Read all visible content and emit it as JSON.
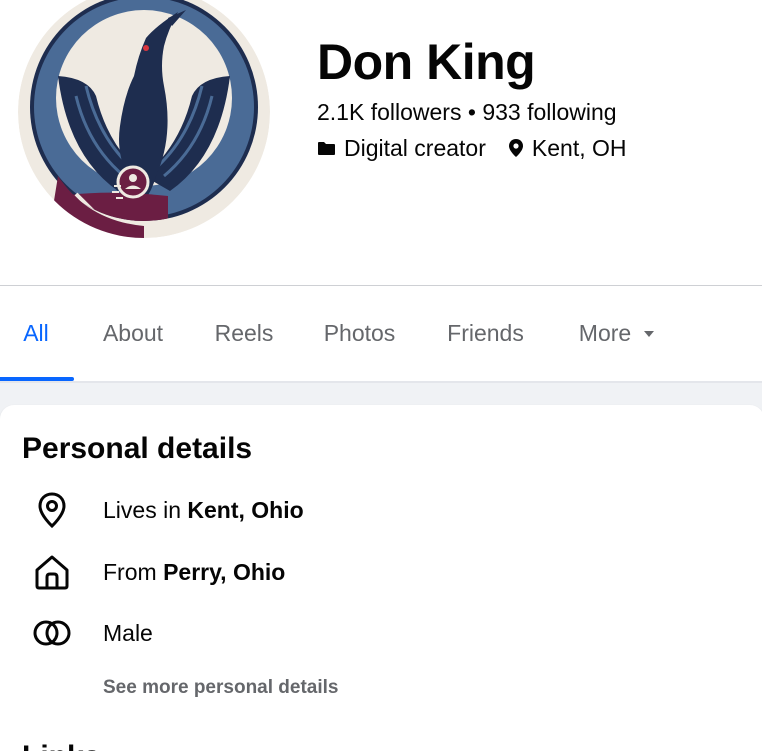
{
  "profile": {
    "name": "Don King",
    "followers": "2.1K followers",
    "separator": "•",
    "following": "933 following",
    "category": "Digital creator",
    "location": "Kent, OH"
  },
  "tabs": [
    {
      "label": "All",
      "active": true
    },
    {
      "label": "About"
    },
    {
      "label": "Reels"
    },
    {
      "label": "Photos"
    },
    {
      "label": "Friends"
    },
    {
      "label": "More"
    }
  ],
  "personal_details": {
    "title": "Personal details",
    "items": [
      {
        "icon": "location-pin-icon",
        "prefix": "Lives in ",
        "value": "Kent, Ohio"
      },
      {
        "icon": "home-icon",
        "prefix": "From ",
        "value": "Perry, Ohio"
      },
      {
        "icon": "gender-icon",
        "prefix": "",
        "value": "Male"
      }
    ],
    "see_more": "See more personal details"
  },
  "links_section": {
    "title": "Links"
  },
  "colors": {
    "accent": "#0866ff",
    "secondary_text": "#65676b",
    "avatar_blue": "#4a6b96",
    "avatar_navy": "#1e2d4f",
    "avatar_ring": "#efeae2",
    "avatar_maroon": "#6b1e43"
  }
}
